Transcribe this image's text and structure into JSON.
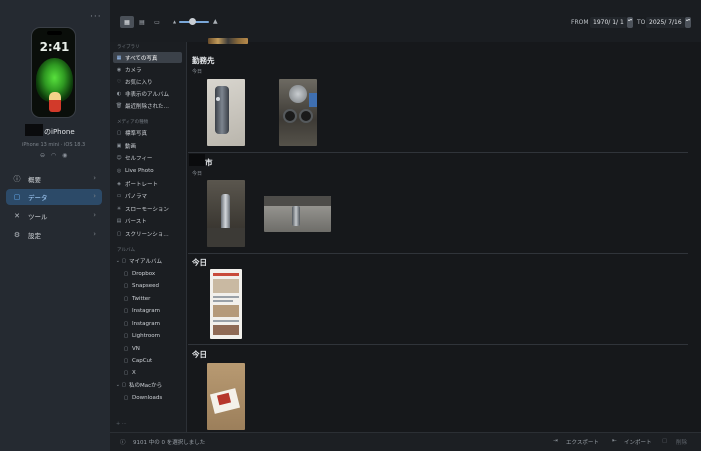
{
  "device": {
    "lock_time": "2:41",
    "name": "のiPhone",
    "subtitle": "iPhone 13 mini · iOS 18.3",
    "status_icons": "⊖ ◠ ◉"
  },
  "more_icon": "···",
  "nav": [
    {
      "label": "概要",
      "icon": "info-icon",
      "glyph": "ⓘ"
    },
    {
      "label": "データ",
      "icon": "folder-icon",
      "glyph": "▢"
    },
    {
      "label": "ツール",
      "icon": "tools-icon",
      "glyph": "✕"
    },
    {
      "label": "設定",
      "icon": "gear-icon",
      "glyph": "⚙"
    }
  ],
  "library": {
    "section_library": "ライブラリ",
    "library_items": [
      {
        "label": "すべての写真",
        "glyph": "▦"
      },
      {
        "label": "カメラ",
        "glyph": "◉"
      },
      {
        "label": "お気に入り",
        "glyph": "♡"
      },
      {
        "label": "非表示のアルバム",
        "glyph": "◐"
      },
      {
        "label": "最近削除された…",
        "glyph": "🗑"
      }
    ],
    "section_media": "メディアの種類",
    "media_items": [
      {
        "label": "標準写真",
        "glyph": "▢"
      },
      {
        "label": "動画",
        "glyph": "▣"
      },
      {
        "label": "セルフィー",
        "glyph": "☺"
      },
      {
        "label": "Live Photo",
        "glyph": "◎"
      },
      {
        "label": "ポートレート",
        "glyph": "◈"
      },
      {
        "label": "パノラマ",
        "glyph": "▭"
      },
      {
        "label": "スローモーション",
        "glyph": "✳"
      },
      {
        "label": "バースト",
        "glyph": "▤"
      },
      {
        "label": "スクリーンショ…",
        "glyph": "▢"
      }
    ],
    "section_album": "アルバム",
    "my_album": "マイアルバム",
    "albums": [
      "Dropbox",
      "Snapseed",
      "Twitter",
      "Instagram",
      "Instagram",
      "Lightroom",
      "VN",
      "CapCut",
      "X"
    ],
    "mac_album": "私のMacから",
    "mac_sub": "Downloads",
    "footer_glyphs": "+  ···"
  },
  "toolbar": {
    "view_modes": [
      "▦",
      "▤",
      "▭"
    ],
    "zoom_small": "▲",
    "zoom_large": "▲",
    "from_label": "FROM",
    "from_date": "1970/ 1/ 1",
    "to_label": "TO",
    "to_date": "2025/ 7/16",
    "stepper": "▴▾"
  },
  "groups": [
    {
      "title": "勤務先",
      "subtitle": "今日"
    },
    {
      "title": "市",
      "subtitle": "今日"
    },
    {
      "title": "今日",
      "subtitle": ""
    },
    {
      "title": "今日",
      "subtitle": ""
    }
  ],
  "bottom": {
    "status": "9101 中の 0 を選択しました",
    "export": "エクスポート",
    "import": "インポート",
    "delete": "削除"
  }
}
